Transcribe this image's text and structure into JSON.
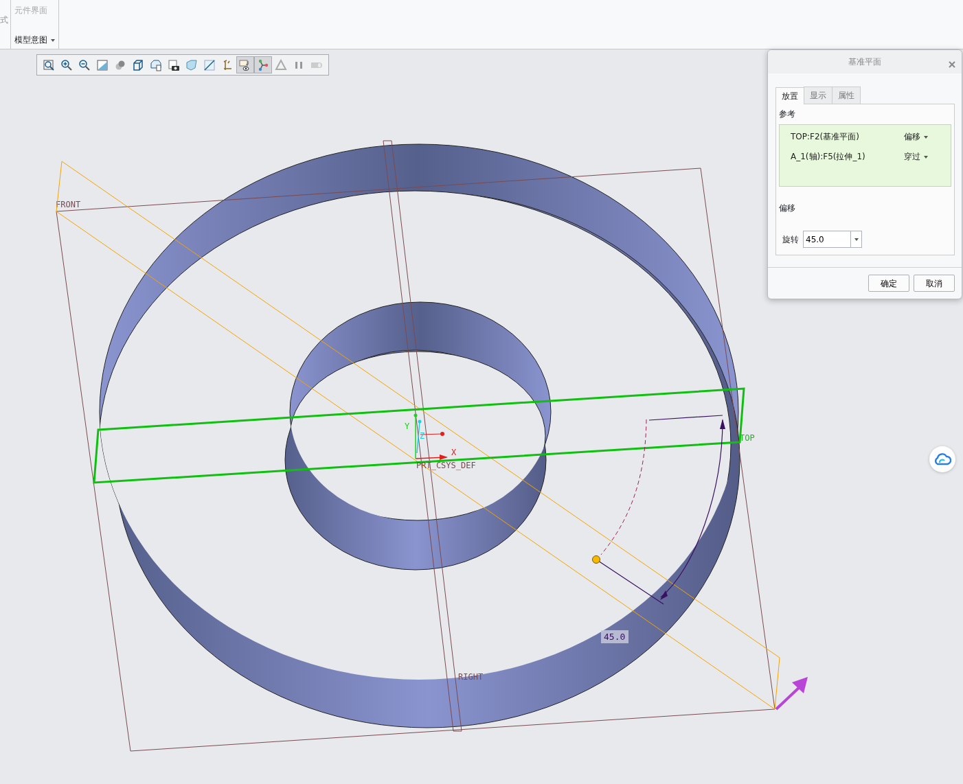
{
  "ribbon": {
    "cut_text": "式",
    "group": {
      "button": {
        "label": "元件界面",
        "disabled": true
      },
      "label": "模型意图"
    }
  },
  "view_toolbar": {
    "buttons": [
      {
        "kind": "refit",
        "selected": false
      },
      {
        "kind": "zoomin",
        "selected": false
      },
      {
        "kind": "zoomout",
        "selected": false
      },
      {
        "kind": "repaint",
        "selected": false
      },
      {
        "kind": "shading",
        "selected": false
      },
      {
        "kind": "cube",
        "selected": false
      },
      {
        "kind": "views",
        "selected": false
      },
      {
        "kind": "camera",
        "selected": false
      },
      {
        "kind": "section",
        "selected": false
      },
      {
        "kind": "plane",
        "selected": false
      },
      {
        "kind": "csys",
        "selected": false
      },
      {
        "kind": "display",
        "selected": true
      },
      {
        "kind": "points",
        "selected": true
      },
      {
        "kind": "triangle",
        "selected": false
      },
      {
        "kind": "pause",
        "selected": false
      },
      {
        "kind": "tube",
        "selected": false
      }
    ]
  },
  "canvas": {
    "planes": {
      "front": "FRONT",
      "top": "TOP",
      "right": "RIGHT"
    },
    "csys": {
      "label": "PRT_CSYS_DEF",
      "x": "X",
      "y": "Y",
      "z": "Z"
    },
    "dimension": "45.0"
  },
  "dialog": {
    "title": "基准平面",
    "tabs": [
      {
        "label": "放置",
        "selected": true
      },
      {
        "label": "显示",
        "selected": false
      },
      {
        "label": "属性",
        "selected": false
      }
    ],
    "references": {
      "label": "参考",
      "rows": [
        {
          "name": "TOP:F2(基准平面)",
          "constraint": "偏移"
        },
        {
          "name": "A_1(轴):F5(拉伸_1)",
          "constraint": "穿过"
        }
      ]
    },
    "offset": {
      "label": "偏移",
      "rotation_label": "旋转",
      "value": "45.0"
    },
    "buttons": [
      "确定",
      "取消"
    ]
  }
}
